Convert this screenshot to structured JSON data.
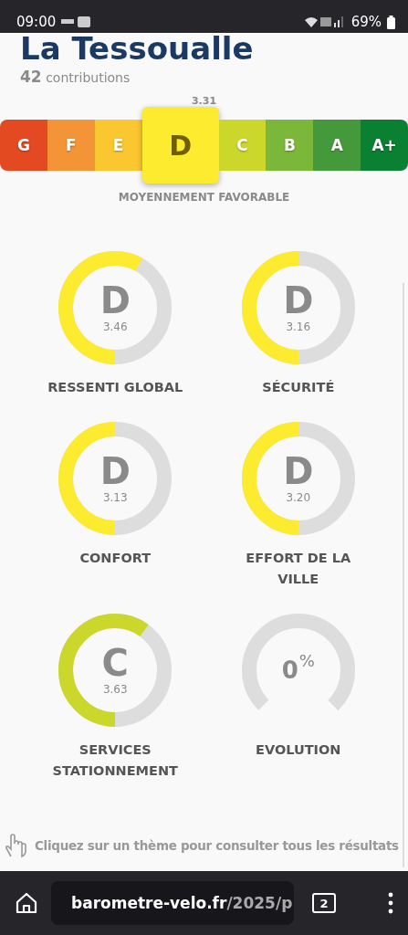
{
  "status_bar": {
    "time": "09:00",
    "battery": "69%"
  },
  "header": {
    "title": "La Tessoualle",
    "count": "42",
    "count_label": "contributions"
  },
  "scale": {
    "score": "3.31",
    "label": "MOYENNEMENT FAVORABLE",
    "grades": [
      {
        "letter": "G",
        "color": "#e34a22",
        "selected": false
      },
      {
        "letter": "F",
        "color": "#f39436",
        "selected": false
      },
      {
        "letter": "E",
        "color": "#fbc730",
        "selected": false
      },
      {
        "letter": "D",
        "color": "#fdeb2f",
        "selected": true
      },
      {
        "letter": "C",
        "color": "#cbd72b",
        "selected": false
      },
      {
        "letter": "B",
        "color": "#7bb83a",
        "selected": false
      },
      {
        "letter": "A",
        "color": "#449a3a",
        "selected": false
      },
      {
        "letter": "A+",
        "color": "#0a8032",
        "selected": false
      }
    ]
  },
  "themes": [
    {
      "kind": "grade",
      "letter": "D",
      "score": "3.46",
      "label": "RESSENTI GLOBAL",
      "level": 0.58,
      "color": "#fdeb2f"
    },
    {
      "kind": "grade",
      "letter": "D",
      "score": "3.16",
      "label": "SÉCURITÉ",
      "level": 0.5,
      "color": "#fdeb2f"
    },
    {
      "kind": "grade",
      "letter": "D",
      "score": "3.13",
      "label": "CONFORT",
      "level": 0.5,
      "color": "#fdeb2f"
    },
    {
      "kind": "grade",
      "letter": "D",
      "score": "3.20",
      "label": "EFFORT DE LA VILLE",
      "level": 0.5,
      "color": "#fdeb2f"
    },
    {
      "kind": "grade",
      "letter": "C",
      "score": "3.63",
      "label": "SERVICES STATIONNEMENT",
      "level": 0.6,
      "color": "#cbd72b"
    },
    {
      "kind": "evolution",
      "value": "0",
      "unit": "%",
      "label": "EVOLUTION"
    }
  ],
  "hint": "Cliquez sur un thème pour consulter tous les résultats",
  "browser": {
    "url_host": "barometre-velo.fr",
    "url_path": "/2025/p",
    "tab_count": "2"
  }
}
